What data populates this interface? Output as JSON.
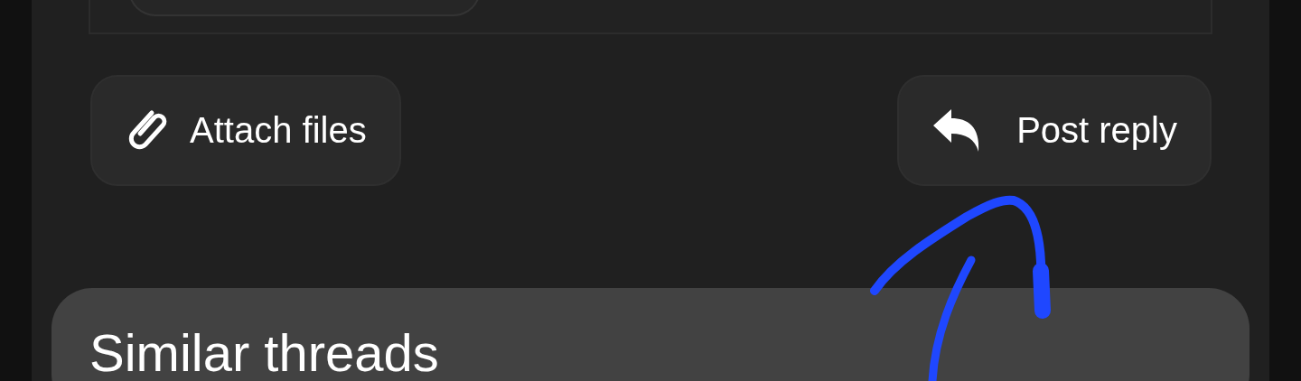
{
  "actions": [
    {
      "kind": "attach",
      "label": "Attach files"
    },
    {
      "kind": "reply",
      "label": "Post reply"
    }
  ],
  "similar_threads": {
    "title": "Similar threads"
  }
}
